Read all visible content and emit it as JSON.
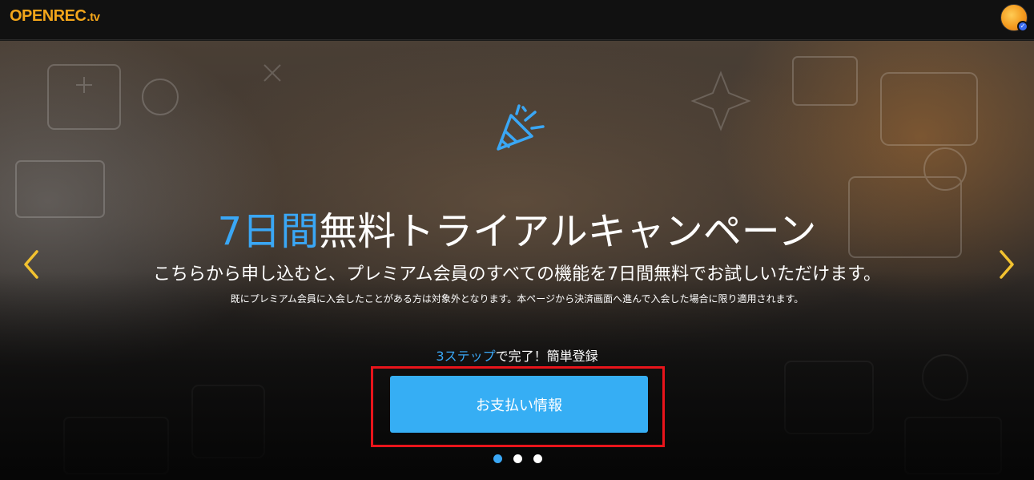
{
  "header": {
    "logo_main": "OPENREC",
    "logo_tld": ".tv"
  },
  "hero": {
    "headline_accent": "7日間",
    "headline_rest": "無料トライアルキャンペーン",
    "subline": "こちらから申し込むと、プレミアム会員のすべての機能を7日間無料でお試しいただけます。",
    "note": "既にプレミアム会員に入会したことがある方は対象外となります。本ページから決済画面へ進んで入会した場合に限り適用されます。",
    "steps_accent": "3ステップ",
    "steps_rest": "で完了！簡単登録",
    "button_label": "お支払い情報"
  },
  "carousel": {
    "slide_count": 3,
    "active_index": 0
  },
  "colors": {
    "accent_blue": "#3aa7f5",
    "button_blue": "#36aef4",
    "logo_orange": "#f2a51a",
    "arrow_yellow": "#f2c230",
    "highlight_red": "#e8141b"
  }
}
